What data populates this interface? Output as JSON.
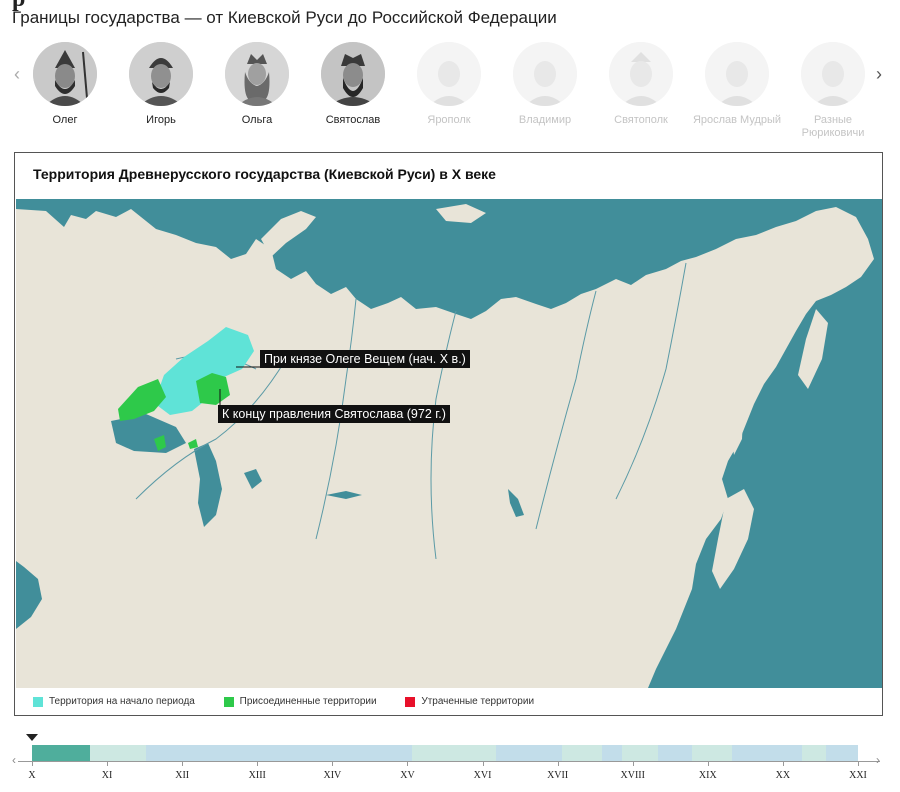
{
  "page": {
    "title_visible_fragment": "р",
    "subtitle": "Границы государства — от Киевской Руси до Российской Федерации"
  },
  "carousel": {
    "prev_icon": "chevron-left-icon",
    "next_icon": "chevron-right-icon",
    "rulers": [
      {
        "name": "Олег",
        "active": true
      },
      {
        "name": "Игорь",
        "active": true
      },
      {
        "name": "Ольга",
        "active": true
      },
      {
        "name": "Святослав",
        "active": true
      },
      {
        "name": "Ярополк",
        "active": false
      },
      {
        "name": "Владимир",
        "active": false
      },
      {
        "name": "Святополк",
        "active": false
      },
      {
        "name": "Ярослав Мудрый",
        "active": false
      },
      {
        "name": "Разные Рюриковичи",
        "active": false
      }
    ]
  },
  "map_card": {
    "title": "Территория Древнерусского государства (Киевской Руси) в X веке",
    "labels": {
      "oleg": "При князе Олеге Вещем (нач. X в.)",
      "svyatoslav": "К концу правления Святослава (972 г.)"
    },
    "legend": [
      {
        "label": "Территория на начало периода",
        "color": "#5fe3d7"
      },
      {
        "label": "Присоединенные территории",
        "color": "#2ec94a"
      },
      {
        "label": "Утраченные территории",
        "color": "#e8102a"
      }
    ],
    "colors": {
      "sea": "#418e9a",
      "land": "#e8e4d8",
      "rivers": "#5b9aa6"
    }
  },
  "timeline": {
    "marker_icon": "triangle-down-icon",
    "centuries": [
      "X",
      "XI",
      "XII",
      "XIII",
      "XIV",
      "XV",
      "XVI",
      "XVII",
      "XVIII",
      "XIX",
      "XX",
      "XXI"
    ],
    "current_century": "X",
    "colors": {
      "active": "#4fae9c",
      "light_green": "#cde8e2",
      "light_blue": "#c2ddea"
    }
  }
}
